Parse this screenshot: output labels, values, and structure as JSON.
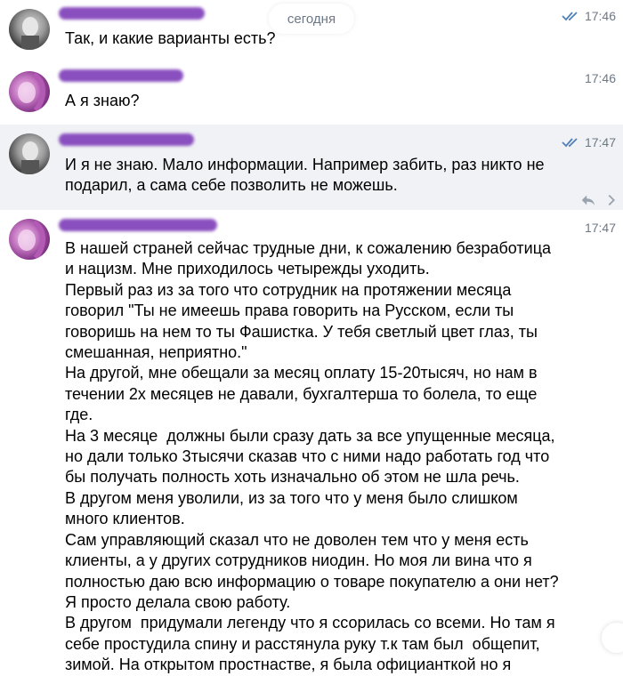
{
  "date_label": "сегодня",
  "messages": [
    {
      "time": "17:46",
      "read": true,
      "text": "Так, и какие варианты есть?"
    },
    {
      "time": "17:46",
      "read": false,
      "text": "А я знаю?"
    },
    {
      "time": "17:47",
      "read": true,
      "text": "И я не знаю. Мало информации. Например забить, раз никто не подарил, а сама себе позволить не можешь."
    },
    {
      "time": "17:47",
      "read": false,
      "text": "В нашей страней сейчас трудные дни, к сожалению безработица и нацизм. Мне приходилось четырежды уходить.\nПервый раз из за того что сотрудник на протяжении месяца говорил \"Ты не имеешь права говорить на Русском, если ты говоришь на нем то ты Фашистка. У тебя светлый цвет глаз, ты смешанная, неприятно.\"\nНа другой, мне обещали за месяц оплату 15-20тысяч, но нам в течении 2х месяцев не давали, бухгалтерша то болела, то еще где.\nНа 3 месяце  должны были сразу дать за все упущенные месяца, но дали только 3тысячи сказав что с ними надо работать год что бы получать полность хоть изначально об этом не шла речь.\nВ другом меня уволили, из за того что у меня было слишком много клиентов.\nСам управляющий сказал что не доволен тем что у меня есть клиенты, а у других сотрудников ниодин. Но моя ли вина что я полностью даю всю информацию о товаре покупателю а они нет? Я просто делала свою работу.\nВ другом  придумали легенду что я ссорилась со всеми. Но там я себе простудила спину и расстянула руку т.к там был  общепит, зимой. На открытом простнастве, я была официанткой но я"
    }
  ],
  "icons": {
    "read_checks": "double-check-icon",
    "reply": "reply-icon",
    "more": "more-icon"
  },
  "colors": {
    "name_redaction": "#8a4fbf",
    "read_checks": "#5181b8",
    "time": "#6d7885",
    "highlight_bg": "#f0f2f5"
  }
}
